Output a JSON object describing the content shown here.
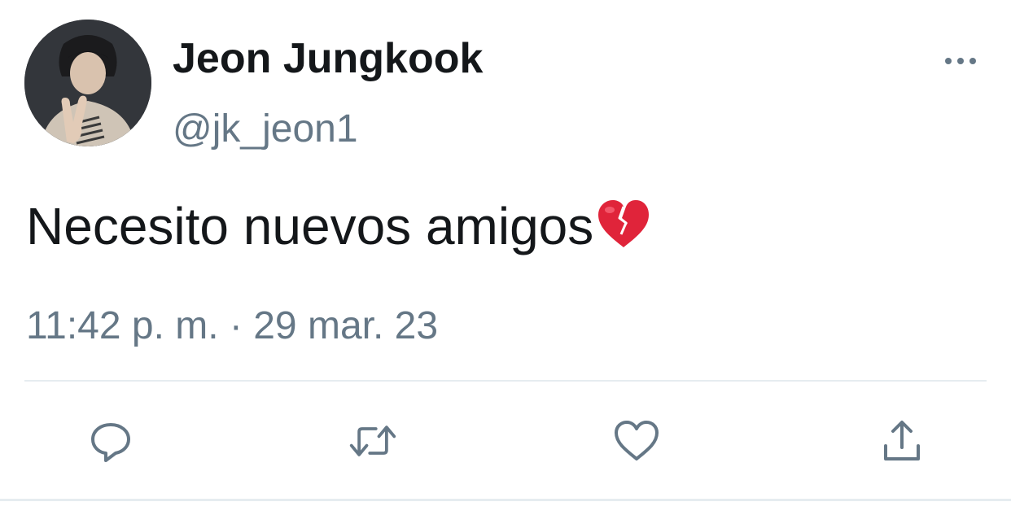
{
  "user": {
    "display_name": "Jeon Jungkook",
    "handle": "@jk_jeon1",
    "avatar_icon": "profile-photo"
  },
  "tweet": {
    "text": "Necesito nuevos amigos",
    "emoji": "broken-heart",
    "timestamp": "11:42 p. m. · 29 mar. 23"
  },
  "actions": {
    "more_icon": "ellipsis-icon",
    "reply_icon": "reply-icon",
    "retweet_icon": "retweet-icon",
    "like_icon": "heart-icon",
    "share_icon": "share-icon"
  },
  "colors": {
    "primary_text": "#14171a",
    "secondary_text": "#657786",
    "icon": "#657786",
    "divider": "#e6ecf0",
    "broken_heart": "#e0243a"
  }
}
